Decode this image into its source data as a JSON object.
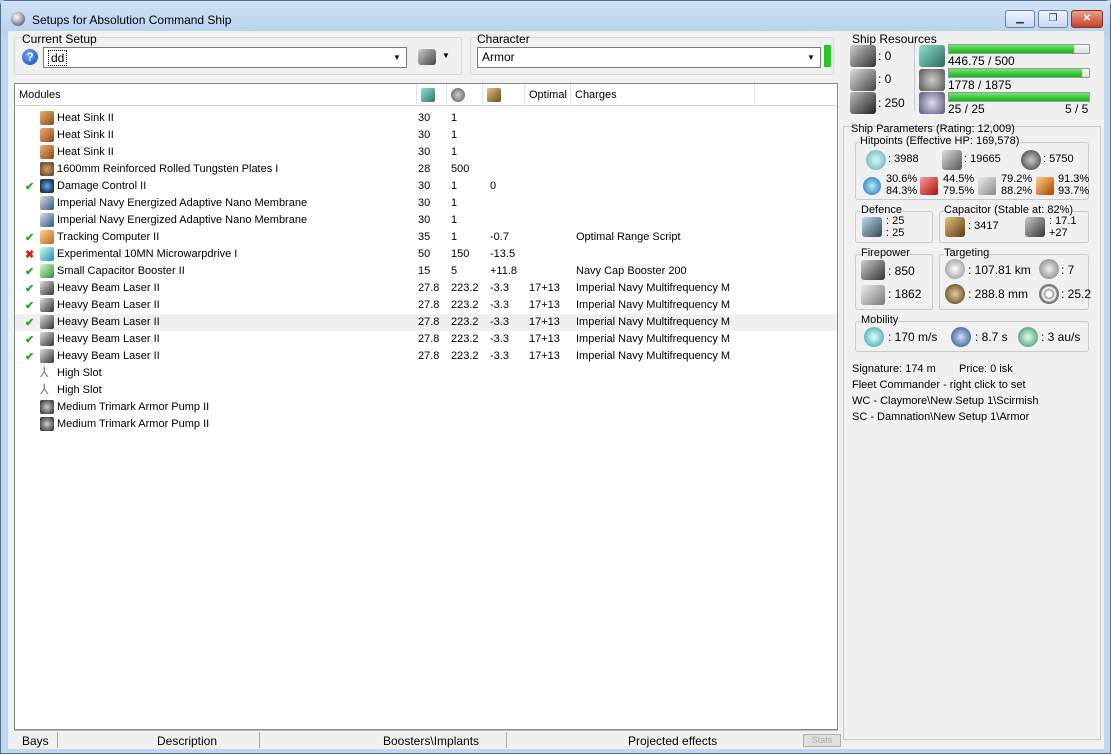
{
  "window": {
    "title": "Setups for Absolution Command Ship",
    "btn_min": "▁",
    "btn_max": "❐",
    "btn_close": "✕"
  },
  "setup": {
    "label": "Current Setup",
    "value": "dd",
    "help": "?"
  },
  "character": {
    "label": "Character",
    "value": "Armor"
  },
  "modules": {
    "columns": [
      "Modules",
      "",
      "",
      "",
      "Optimal",
      "Charges"
    ],
    "rows": [
      {
        "status": "",
        "icon": "heat",
        "name": "Heat Sink II",
        "cpu": "30",
        "pg": "1",
        "cap": "",
        "optimal": "",
        "charges": ""
      },
      {
        "status": "",
        "icon": "heat",
        "name": "Heat Sink II",
        "cpu": "30",
        "pg": "1",
        "cap": "",
        "optimal": "",
        "charges": ""
      },
      {
        "status": "",
        "icon": "heat",
        "name": "Heat Sink II",
        "cpu": "30",
        "pg": "1",
        "cap": "",
        "optimal": "",
        "charges": ""
      },
      {
        "status": "",
        "icon": "plate",
        "name": "1600mm Reinforced Rolled Tungsten Plates I",
        "cpu": "28",
        "pg": "500",
        "cap": "",
        "optimal": "",
        "charges": ""
      },
      {
        "status": "✔",
        "icon": "dc",
        "name": "Damage Control II",
        "cpu": "30",
        "pg": "1",
        "cap": "0",
        "optimal": "",
        "charges": ""
      },
      {
        "status": "",
        "icon": "nano",
        "name": "Imperial Navy Energized Adaptive Nano Membrane",
        "cpu": "30",
        "pg": "1",
        "cap": "",
        "optimal": "",
        "charges": ""
      },
      {
        "status": "",
        "icon": "nano",
        "name": "Imperial Navy Energized Adaptive Nano Membrane",
        "cpu": "30",
        "pg": "1",
        "cap": "",
        "optimal": "",
        "charges": ""
      },
      {
        "status": "✔",
        "icon": "comp",
        "name": "Tracking Computer II",
        "cpu": "35",
        "pg": "1",
        "cap": "-0.7",
        "optimal": "",
        "charges": "Optimal Range Script"
      },
      {
        "status": "✖",
        "icon": "mwd",
        "name": "Experimental 10MN Microwarpdrive I",
        "cpu": "50",
        "pg": "150",
        "cap": "-13.5",
        "optimal": "",
        "charges": ""
      },
      {
        "status": "✔",
        "icon": "cap",
        "name": "Small Capacitor Booster II",
        "cpu": "15",
        "pg": "5",
        "cap": "+11.8",
        "optimal": "",
        "charges": "Navy Cap Booster 200"
      },
      {
        "status": "✔",
        "icon": "laser",
        "name": "Heavy Beam Laser II",
        "cpu": "27.8",
        "pg": "223.2",
        "cap": "-3.3",
        "optimal": "17+13",
        "charges": "Imperial Navy Multifrequency M"
      },
      {
        "status": "✔",
        "icon": "laser",
        "name": "Heavy Beam Laser II",
        "cpu": "27.8",
        "pg": "223.2",
        "cap": "-3.3",
        "optimal": "17+13",
        "charges": "Imperial Navy Multifrequency M"
      },
      {
        "status": "✔",
        "icon": "laser",
        "name": "Heavy Beam Laser II",
        "cpu": "27.8",
        "pg": "223.2",
        "cap": "-3.3",
        "optimal": "17+13",
        "charges": "Imperial Navy Multifrequency M"
      },
      {
        "status": "✔",
        "icon": "laser",
        "name": "Heavy Beam Laser II",
        "cpu": "27.8",
        "pg": "223.2",
        "cap": "-3.3",
        "optimal": "17+13",
        "charges": "Imperial Navy Multifrequency M"
      },
      {
        "status": "✔",
        "icon": "laser",
        "name": "Heavy Beam Laser II",
        "cpu": "27.8",
        "pg": "223.2",
        "cap": "-3.3",
        "optimal": "17+13",
        "charges": "Imperial Navy Multifrequency M"
      },
      {
        "status": "",
        "icon": "slot",
        "name": "High Slot",
        "cpu": "",
        "pg": "",
        "cap": "",
        "optimal": "",
        "charges": ""
      },
      {
        "status": "",
        "icon": "slot",
        "name": "High Slot",
        "cpu": "",
        "pg": "",
        "cap": "",
        "optimal": "",
        "charges": ""
      },
      {
        "status": "",
        "icon": "pump",
        "name": "Medium Trimark Armor Pump II",
        "cpu": "",
        "pg": "",
        "cap": "",
        "optimal": "",
        "charges": ""
      },
      {
        "status": "",
        "icon": "pump",
        "name": "Medium Trimark Armor Pump II",
        "cpu": "",
        "pg": "",
        "cap": "",
        "optimal": "",
        "charges": ""
      }
    ]
  },
  "statusbar": {
    "bays": "Bays",
    "description": "Description",
    "boosters": "Boosters\\Implants",
    "projected": "Projected effects",
    "stats": "Stats"
  },
  "resources": {
    "title": "Ship Resources",
    "turrets": ": 0",
    "launchers": ": 0",
    "drones": ": 250",
    "cpu": "446.75 / 500",
    "cpu_fraction": 0.894,
    "powergrid": "1778 / 1875",
    "powergrid_fraction": 0.948,
    "calibration": "25 / 25",
    "calibration_fraction": 1.0,
    "slots": "5 / 5"
  },
  "params": {
    "title": "Ship Parameters (Rating: 12,009)",
    "hp_title": "Hitpoints (Effective HP: 169,578)",
    "shield": ": 3988",
    "armor": ": 19665",
    "structure": ": 5750",
    "res": [
      {
        "a": "30.6%",
        "b": "84.3%"
      },
      {
        "a": "44.5%",
        "b": "79.5%"
      },
      {
        "a": "79.2%",
        "b": "88.2%"
      },
      {
        "a": "91.3%",
        "b": "93.7%"
      }
    ],
    "defence_title": "Defence",
    "def1": ": 25",
    "def2": ": 25",
    "cap_title": "Capacitor (Stable at: 82%)",
    "cap_amount": ": 3417",
    "cap_rate1": ": 17.1",
    "cap_rate2": "+27",
    "fire_title": "Firepower",
    "dps": ": 850",
    "volley": ": 1862",
    "targ_title": "Targeting",
    "range": ": 107.81 km",
    "targets": ": 7",
    "res_mm": ": 288.8 mm",
    "scan": ": 25.2",
    "mob_title": "Mobility",
    "speed": ": 170 m/s",
    "align": ": 8.7 s",
    "warp": ": 3 au/s",
    "signature": "Signature: 174 m",
    "price": "Price: 0 isk",
    "fleet": "Fleet Commander - right click to set",
    "wc": "WC - Claymore\\New Setup 1\\Scirmish",
    "sc": "SC - Damnation\\New Setup 1\\Armor"
  }
}
